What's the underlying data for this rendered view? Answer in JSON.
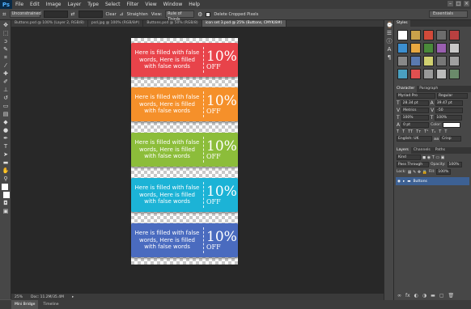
{
  "menubar": {
    "logo": "Ps",
    "items": [
      "File",
      "Edit",
      "Image",
      "Layer",
      "Type",
      "Select",
      "Filter",
      "View",
      "Window",
      "Help"
    ]
  },
  "options": {
    "ratio": "Unconstrained",
    "clear": "Clear",
    "straighten": "Straighten",
    "view_label": "View:",
    "view_value": "Rule of Thirds",
    "delete_cropped": "Delete Cropped Pixels",
    "workspace": "Essentials"
  },
  "doc_tabs": [
    {
      "label": "Buttons.psd @ 100% (Layer 2, RGB/8)"
    },
    {
      "label": "psd.jpg @ 100% (RGB/8#)"
    },
    {
      "label": "Buttons.psd @ 50% (RGB/8)"
    },
    {
      "label": "icon set 3.psd @ 25% (Buttons, CMYK/8#)",
      "active": true
    }
  ],
  "banners": [
    {
      "text": "Here is filled with false words, Here is filled with false words",
      "big": "10%",
      "off": "OFF",
      "color": "#e8434a"
    },
    {
      "text": "Here is filled with false words, Here is filled with false words",
      "big": "10%",
      "off": "OFF",
      "color": "#f5902a"
    },
    {
      "text": "Here is filled with false words, Here is filled with false words",
      "big": "10%",
      "off": "OFF",
      "color": "#8cbd3a"
    },
    {
      "text": "Here is filled with false words, Here is filled with false words",
      "big": "10%",
      "off": "OFF",
      "color": "#1cb3d6"
    },
    {
      "text": "Here is filled with false words, Here is filled with false words",
      "big": "10%",
      "off": "OFF",
      "color": "#4a6bbf"
    }
  ],
  "status": {
    "zoom": "25%",
    "doc_size": "Doc: 11.2M/35.4M"
  },
  "bottom_tabs": [
    "Mini Bridge",
    "Timeline"
  ],
  "panels": {
    "styles_title": "Styles",
    "character_tab": "Character",
    "paragraph_tab": "Paragraph",
    "font_family": "Myriad Pro",
    "font_style": "Regular",
    "font_size": "28.34 pt",
    "leading": "39.47 pt",
    "kerning": "Metrics",
    "tracking": "-50",
    "vscale": "100%",
    "hscale": "100%",
    "baseline": "0 pt",
    "color_label": "Color:",
    "language": "English: UK",
    "aa": "Crisp",
    "layers_tab": "Layers",
    "channels_tab": "Channels",
    "paths_tab": "Paths",
    "kind": "Kind",
    "blend": "Pass Through",
    "opacity": "Opacity:",
    "opacity_val": "100%",
    "lock": "Lock:",
    "fill": "Fill:",
    "fill_val": "100%",
    "layer_name": "Buttons"
  }
}
